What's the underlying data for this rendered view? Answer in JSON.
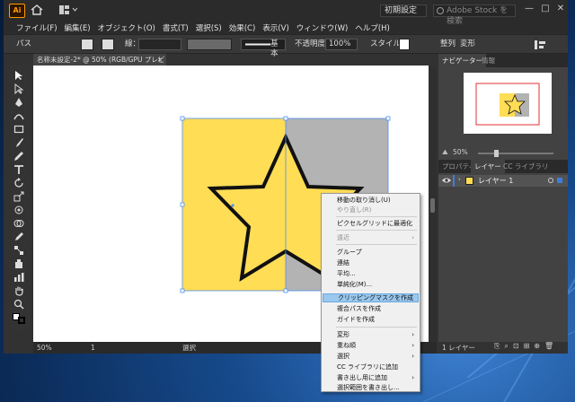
{
  "window": {
    "logo": "Ai",
    "workspace": "初期設定",
    "stock_search_placeholder": "Adobe Stock を検索",
    "min": "—",
    "max": "□",
    "close": "✕"
  },
  "menu": [
    "ファイル(F)",
    "編集(E)",
    "オブジェクト(O)",
    "書式(T)",
    "選択(S)",
    "効果(C)",
    "表示(V)",
    "ウィンドウ(W)",
    "ヘルプ(H)"
  ],
  "control": {
    "path_label": "パス",
    "stroke_label": "線：",
    "stroke_profile": "基本",
    "opacity_label": "不透明度：",
    "opacity_value": "100%",
    "style_label": "スタイル：",
    "align_label": "整列",
    "transform_label": "変形"
  },
  "doc_tab": {
    "title": "名称未設定-2* @ 50% (RGB/GPU プレビュー)",
    "close": "×"
  },
  "status": {
    "zoom": "50%",
    "artboard": "1",
    "tool": "選択"
  },
  "panels": {
    "nav_tabs": [
      "ナビゲーター",
      "情報"
    ],
    "nav_zoom": "50%",
    "layer_tabs": [
      "プロパティ",
      "レイヤー",
      "CC ライブラリ"
    ],
    "layer_name": "レイヤー 1",
    "layer_count": "1 レイヤー"
  },
  "context_menu": {
    "items": [
      {
        "label": "移動の取り消し(U)",
        "disabled": false
      },
      {
        "label": "やり直し(R)",
        "disabled": true
      },
      {
        "label": "ピクセルグリッドに最適化",
        "disabled": false
      },
      {
        "label": "遠近",
        "disabled": true,
        "submenu": true
      },
      {
        "label": "グループ",
        "disabled": false
      },
      {
        "label": "連結",
        "disabled": false
      },
      {
        "label": "平均...",
        "disabled": false
      },
      {
        "label": "単純化(M)...",
        "disabled": false
      },
      {
        "label": "クリッピングマスクを作成",
        "disabled": false,
        "highlighted": true
      },
      {
        "label": "複合パスを作成",
        "disabled": false
      },
      {
        "label": "ガイドを作成",
        "disabled": false
      },
      {
        "label": "変形",
        "disabled": false,
        "submenu": true
      },
      {
        "label": "重ね順",
        "disabled": false,
        "submenu": true
      },
      {
        "label": "選択",
        "disabled": false,
        "submenu": true
      },
      {
        "label": "CC ライブラリに追加",
        "disabled": false
      },
      {
        "label": "書き出し用に追加",
        "disabled": false,
        "submenu": true
      },
      {
        "label": "選択範囲を書き出し...",
        "disabled": false
      }
    ]
  },
  "colors": {
    "star_fill": "#ffdd55",
    "rect_yellow": "#ffdd55",
    "rect_gray": "#b3b3b3",
    "selection": "#4f8ff0",
    "highlight": "#9ac8ee"
  }
}
